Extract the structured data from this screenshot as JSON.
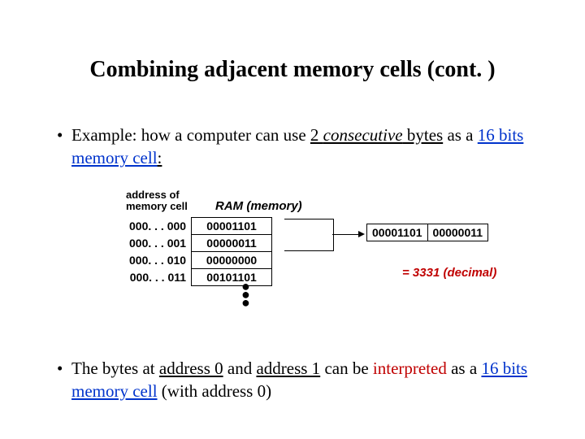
{
  "title": "Combining adjacent memory cells (cont. )",
  "b1": {
    "pre": "Example: how a computer can use ",
    "link1": "2 ",
    "link1b": "consecutive",
    "link1c": " bytes",
    "mid": " as a ",
    "bits": "16 bits memory cell",
    "colon": ":"
  },
  "diagram": {
    "addr_header_l1": "address of",
    "addr_header_l2": "memory cell",
    "ram_label": "RAM (memory)",
    "rows": {
      "a0": "000. . . 000",
      "v0": "00001101",
      "a1": "000. . . 001",
      "v1": "00000011",
      "a2": "000. . . 010",
      "v2": "00000000",
      "a3": "000. . . 011",
      "v3": "00101101"
    },
    "combined_left": "00001101",
    "combined_right": "00000011",
    "result": "= 3331 (decimal)"
  },
  "b2": {
    "pre": "The bytes at ",
    "a0": "address 0",
    "and": " and ",
    "a1": "address 1",
    "mid": " can be ",
    "interp": "interpreted",
    "mid2": " as a ",
    "bits": "16 bits memory cell",
    "post": " (with address 0)"
  }
}
